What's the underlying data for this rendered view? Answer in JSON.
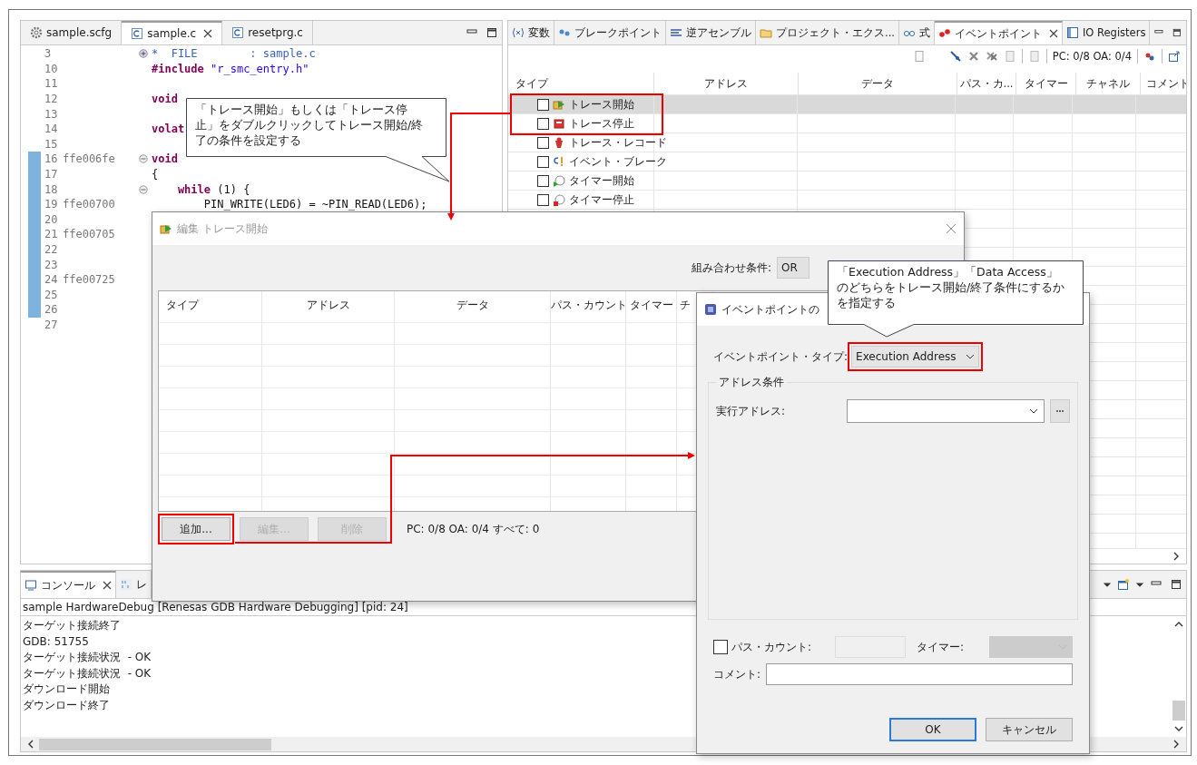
{
  "editor": {
    "tabs": [
      {
        "label": "sample.scfg",
        "kind": "config",
        "selected": false
      },
      {
        "label": "sample.c",
        "kind": "source",
        "selected": true
      },
      {
        "label": "resetprg.c",
        "kind": "source",
        "selected": false
      }
    ],
    "lines": [
      {
        "number": "3",
        "expanded": false,
        "marked": false,
        "code": [
          {
            "text": "*  FILE        : sample.c",
            "kind": "comment"
          }
        ]
      },
      {
        "number": "10",
        "marked": false,
        "code": [
          {
            "text": "#include ",
            "kind": "keyword"
          },
          {
            "text": "\"r_smc_entry.h\"",
            "kind": "string"
          }
        ]
      },
      {
        "number": "11",
        "marked": false
      },
      {
        "number": "12",
        "marked": false,
        "code": [
          {
            "text": "void",
            "kind": "keyword"
          }
        ]
      },
      {
        "number": "13",
        "marked": false
      },
      {
        "number": "14",
        "marked": false,
        "code": [
          {
            "text": "volat",
            "kind": "keyword"
          }
        ]
      },
      {
        "number": "15",
        "marked": false
      },
      {
        "number": "16",
        "address": "ffe006fe",
        "expanded": true,
        "marked": true,
        "code": [
          {
            "text": "void",
            "kind": "keyword"
          }
        ]
      },
      {
        "number": "17",
        "marked": true,
        "code": [
          {
            "text": "{",
            "kind": "plain"
          }
        ]
      },
      {
        "number": "18",
        "expanded": true,
        "marked": true,
        "code": [
          {
            "text": "    while",
            "kind": "keyword"
          },
          {
            "text": " (1) {",
            "kind": "plain"
          }
        ]
      },
      {
        "number": "19",
        "address": "ffe00700",
        "marked": true,
        "code": [
          {
            "text": "        PIN_WRITE(LED6) = ~PIN_READ(LED6);",
            "kind": "plain"
          }
        ]
      },
      {
        "number": "20",
        "marked": true
      },
      {
        "number": "21",
        "address": "ffe00705",
        "marked": true
      },
      {
        "number": "22",
        "marked": true
      },
      {
        "number": "23",
        "marked": true
      },
      {
        "number": "24",
        "address": "ffe00725",
        "marked": true
      },
      {
        "number": "25",
        "marked": true
      },
      {
        "number": "26",
        "marked": true
      },
      {
        "number": "27",
        "marked": false
      }
    ]
  },
  "views": {
    "tabs": [
      {
        "label": "変数",
        "selected": false
      },
      {
        "label": "ブレークポイント",
        "selected": false
      },
      {
        "label": "逆アセンブル",
        "selected": false
      },
      {
        "label": "プロジェクト・エクス...",
        "selected": false
      },
      {
        "label": "式",
        "selected": false
      },
      {
        "label": "イベントポイント",
        "selected": true
      },
      {
        "label": "IO Registers",
        "selected": false
      }
    ],
    "status": "PC: 0/8 OA: 0/4",
    "columns": [
      "タイプ",
      "アドレス",
      "データ",
      "パス・カ...",
      "タイマー",
      "チャネル",
      "コメント"
    ],
    "rows": [
      {
        "label": "トレース開始",
        "checked": false,
        "selected": true
      },
      {
        "label": "トレース停止",
        "checked": false,
        "selected": false
      },
      {
        "label": "トレース・レコード",
        "checked": false,
        "selected": false
      },
      {
        "label": "イベント・ブレーク",
        "checked": false,
        "selected": false
      },
      {
        "label": "タイマー開始",
        "checked": false,
        "selected": false
      },
      {
        "label": "タイマー停止",
        "checked": false,
        "selected": false
      }
    ]
  },
  "console": {
    "tabs": [
      {
        "label": "コンソール",
        "selected": true
      },
      {
        "label": "レ",
        "selected": false
      }
    ],
    "session": "sample HardwareDebug [Renesas GDB Hardware Debugging]  [pid: 24]",
    "lines": [
      "ターゲット接続終了",
      "GDB: 51755",
      "ターゲット接続状況  - OK",
      "ターゲット接続状況  - OK",
      "ダウンロード開始",
      "ダウンロード終了"
    ]
  },
  "edit_dialog": {
    "title": "編集 トレース開始",
    "combination_label": "組み合わせ条件:",
    "combination_value": "OR",
    "columns": [
      "タイプ",
      "アドレス",
      "データ",
      "パス・カウント",
      "タイマー",
      "チ"
    ],
    "buttons": [
      {
        "label": "追加...",
        "disabled": false
      },
      {
        "label": "編集...",
        "disabled": true
      },
      {
        "label": "削除",
        "disabled": true
      }
    ],
    "status": "PC: 0/8 OA: 0/4 すべて: 0"
  },
  "add_dialog": {
    "title": "イベントポイントの",
    "type_label": "イベントポイント・タイプ:",
    "type_value": "Execution Address",
    "group_label": "アドレス条件",
    "address_label": "実行アドレス:",
    "pass_count": {
      "label": "パス・カウント:",
      "checked": false
    },
    "timer_label": "タイマー:",
    "comment_label": "コメント:",
    "buttons": [
      {
        "label": "OK",
        "default": true
      },
      {
        "label": "キャンセル",
        "default": false
      }
    ]
  },
  "callouts": [
    {
      "text": "「トレース開始」もしくは「トレース停止」をダブルクリックしてトレース開始/終了の条件を設定する"
    },
    {
      "text": "「Execution Address」「Data Access」のどちらをトレース開始/終了条件にするかを指定する"
    }
  ]
}
